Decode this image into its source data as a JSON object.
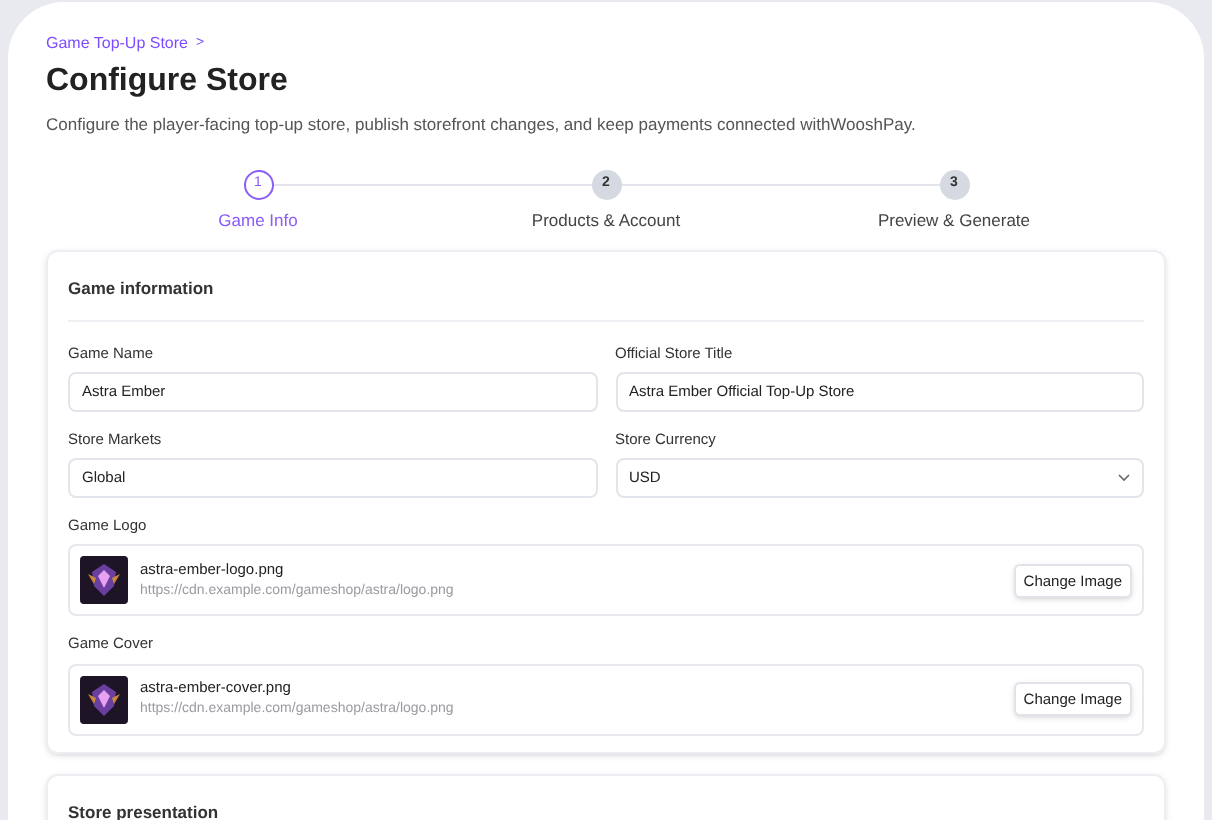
{
  "breadcrumb": "Game Top-Up Store",
  "breadcrumb_separator": ">",
  "title": "Configure Store",
  "description": "Configure the player-facing top-up store, publish storefront changes, and keep payments connected withWooshPay.",
  "steps": [
    {
      "number": "1",
      "label": "Game Info",
      "selected": true
    },
    {
      "number": "2",
      "label": "Products & Account",
      "selected": false
    },
    {
      "number": "3",
      "label": "Preview & Generate",
      "selected": false
    }
  ],
  "section": {
    "title": "Game information",
    "fields": [
      {
        "kind": "text",
        "label": "Game Name",
        "value": "Astra Ember"
      },
      {
        "kind": "text",
        "label": "Official Store Title",
        "value": "Astra Ember Official Top-Up Store"
      },
      {
        "kind": "text",
        "label": "Store Markets",
        "value": "Global"
      },
      {
        "kind": "select",
        "label": "Store Currency",
        "value": "USD"
      }
    ],
    "images": [
      {
        "label": "Game Logo",
        "filename": "astra-ember-logo.png",
        "url": "https://cdn.example.com/gameshop/astra/logo.png",
        "button": "Change Image"
      },
      {
        "label": "Game Cover",
        "filename": "astra-ember-cover.png",
        "url": "https://cdn.example.com/gameshop/astra/logo.png",
        "button": "Change Image"
      }
    ]
  },
  "next_section": {
    "title": "Store presentation"
  }
}
